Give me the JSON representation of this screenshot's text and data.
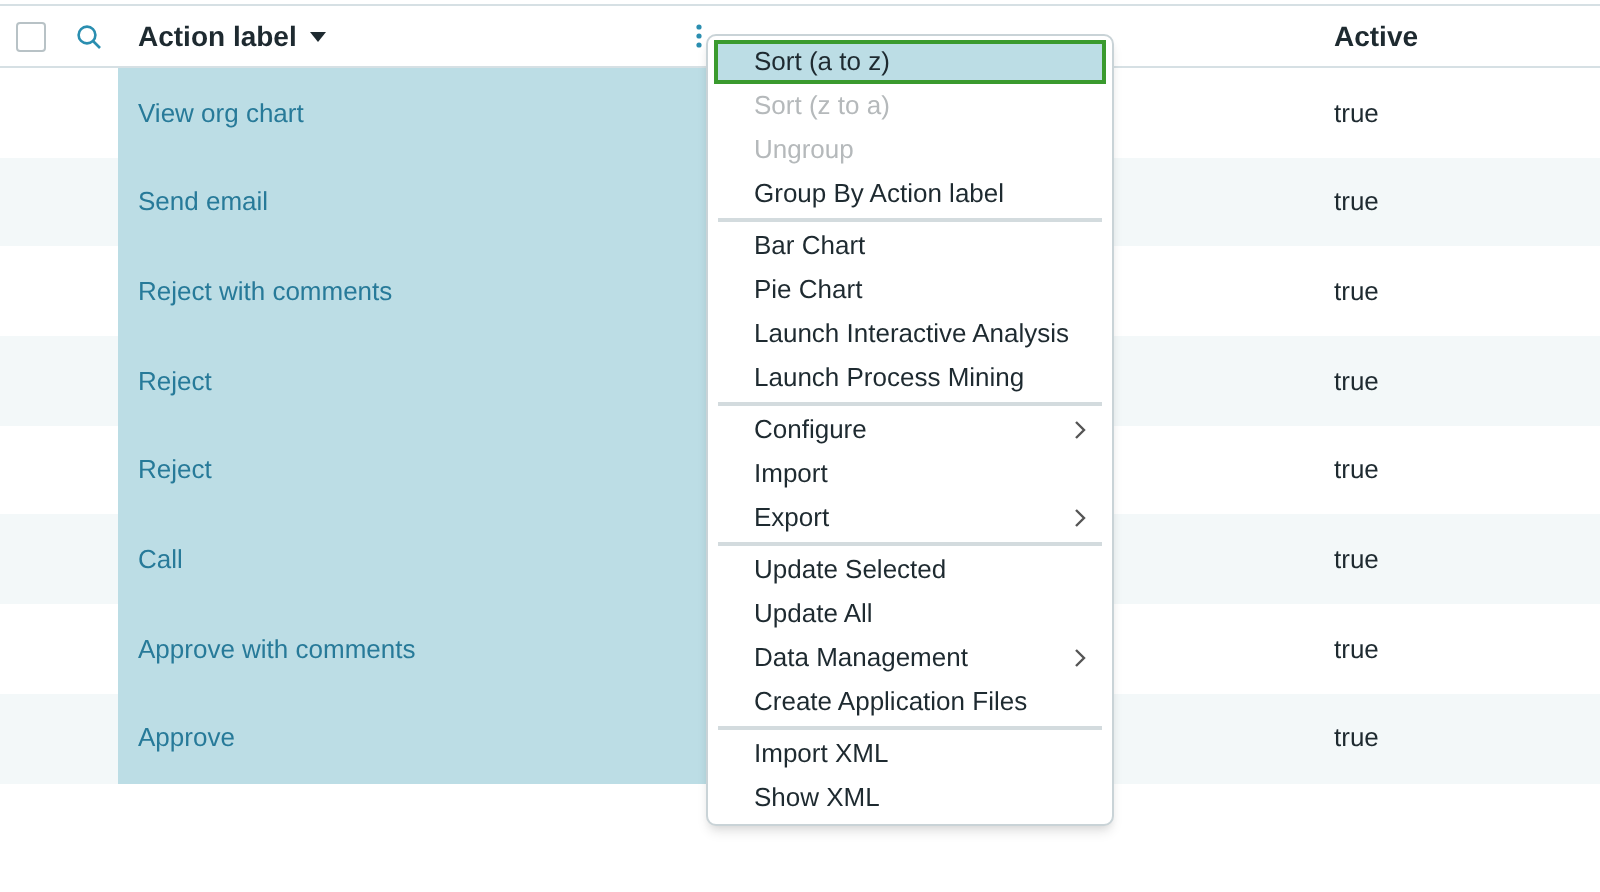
{
  "table": {
    "select_all_checkbox": {
      "checked": false
    },
    "columns": [
      {
        "label": "Action label",
        "selected": true
      },
      {
        "label": "Active",
        "selected": false
      }
    ],
    "rows": [
      {
        "action_label": "View org chart",
        "active": "true"
      },
      {
        "action_label": "Send email",
        "active": "true"
      },
      {
        "action_label": "Reject with comments",
        "active": "true"
      },
      {
        "action_label": "Reject",
        "active": "true"
      },
      {
        "action_label": "Reject",
        "active": "true"
      },
      {
        "action_label": "Call",
        "active": "true"
      },
      {
        "action_label": "Approve with comments",
        "active": "true"
      },
      {
        "action_label": "Approve",
        "active": "true"
      }
    ]
  },
  "menu": {
    "groups": [
      [
        {
          "label": "Sort (a to z)",
          "selected": true,
          "disabled": false,
          "submenu": false
        },
        {
          "label": "Sort (z to a)",
          "selected": false,
          "disabled": true,
          "submenu": false
        },
        {
          "label": "Ungroup",
          "selected": false,
          "disabled": true,
          "submenu": false
        },
        {
          "label": "Group By Action label",
          "selected": false,
          "disabled": false,
          "submenu": false
        }
      ],
      [
        {
          "label": "Bar Chart",
          "selected": false,
          "disabled": false,
          "submenu": false
        },
        {
          "label": "Pie Chart",
          "selected": false,
          "disabled": false,
          "submenu": false
        },
        {
          "label": "Launch Interactive Analysis",
          "selected": false,
          "disabled": false,
          "submenu": false
        },
        {
          "label": "Launch Process Mining",
          "selected": false,
          "disabled": false,
          "submenu": false
        }
      ],
      [
        {
          "label": "Configure",
          "selected": false,
          "disabled": false,
          "submenu": true
        },
        {
          "label": "Import",
          "selected": false,
          "disabled": false,
          "submenu": false
        },
        {
          "label": "Export",
          "selected": false,
          "disabled": false,
          "submenu": true
        }
      ],
      [
        {
          "label": "Update Selected",
          "selected": false,
          "disabled": false,
          "submenu": false
        },
        {
          "label": "Update All",
          "selected": false,
          "disabled": false,
          "submenu": false
        },
        {
          "label": "Data Management",
          "selected": false,
          "disabled": false,
          "submenu": true
        },
        {
          "label": "Create Application Files",
          "selected": false,
          "disabled": false,
          "submenu": false
        }
      ],
      [
        {
          "label": "Import XML",
          "selected": false,
          "disabled": false,
          "submenu": false
        },
        {
          "label": "Show XML",
          "selected": false,
          "disabled": false,
          "submenu": false
        }
      ]
    ]
  }
}
